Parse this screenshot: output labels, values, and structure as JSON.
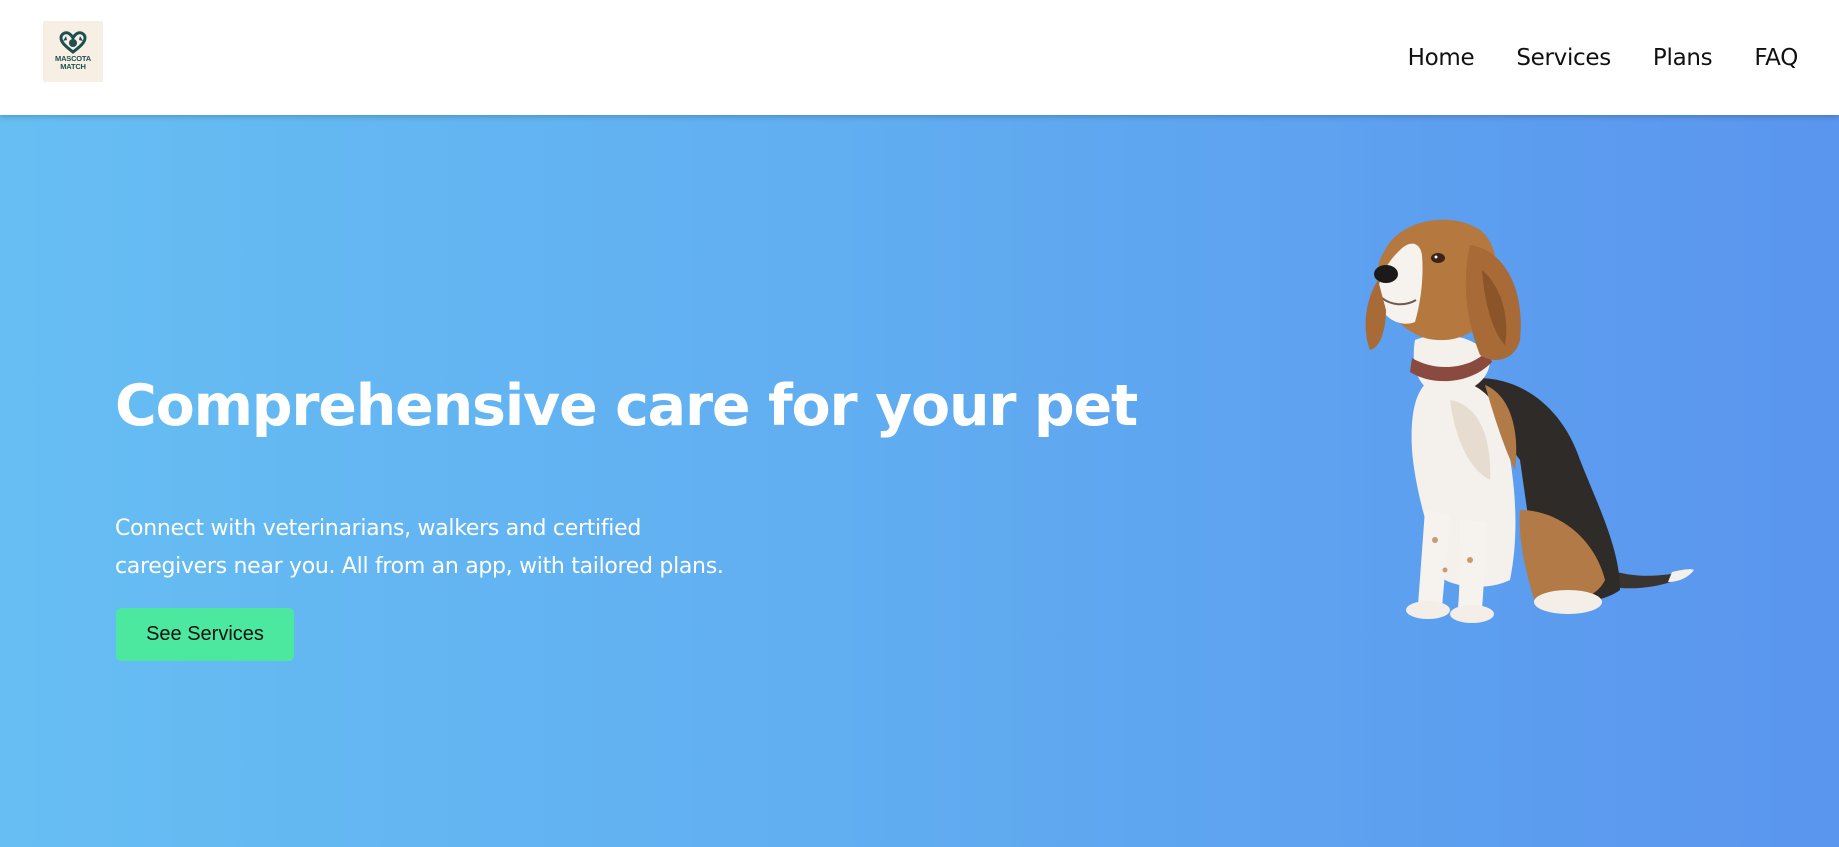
{
  "brand": {
    "logo_text": "MASCOTA MATCH",
    "logo_color": "#1f4f4f",
    "logo_bg": "#f7efe4"
  },
  "nav": {
    "items": [
      {
        "label": "Home"
      },
      {
        "label": "Services"
      },
      {
        "label": "Plans"
      },
      {
        "label": "FAQ"
      }
    ]
  },
  "hero": {
    "title": "Comprehensive care for your pet",
    "description": "Connect with veterinarians, walkers and certified caregivers near you. All from an app, with tailored plans.",
    "cta_label": "See Services",
    "image_icon": "beagle-dog",
    "colors": {
      "gradient_start": "#66bef3",
      "gradient_end": "#5a95ee",
      "cta_bg": "#4de89f"
    }
  }
}
